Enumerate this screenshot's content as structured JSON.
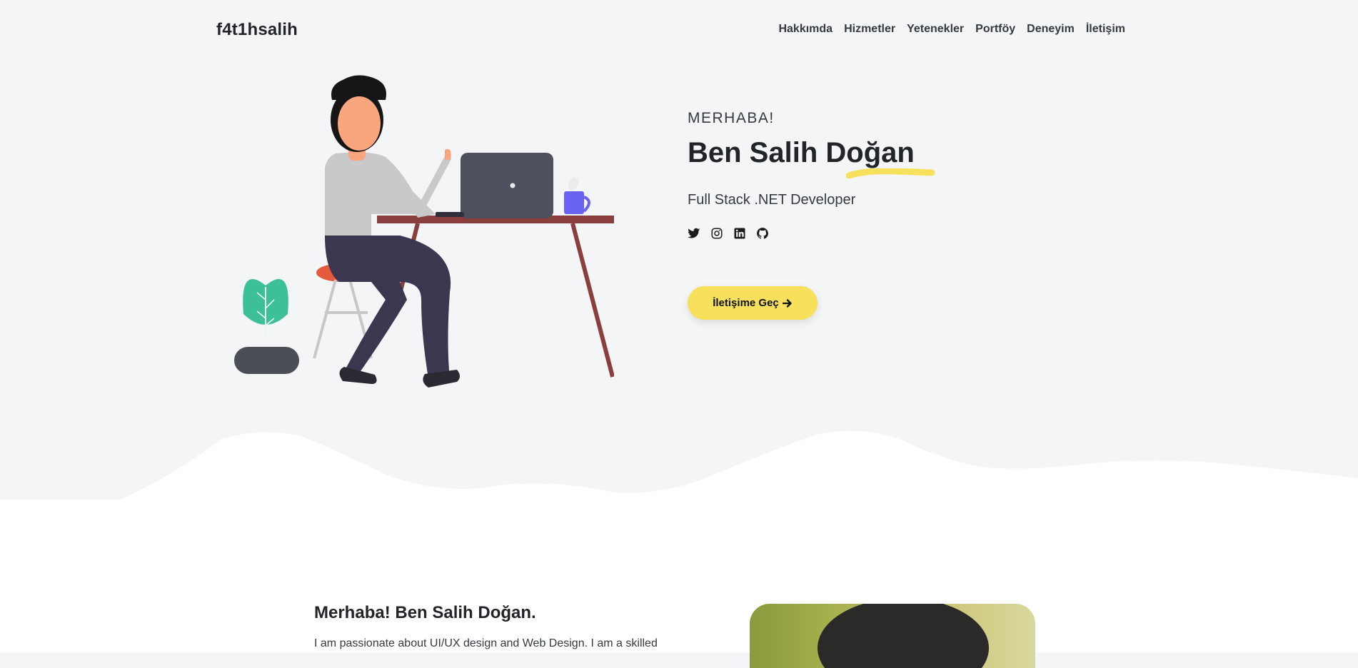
{
  "brand": "f4t1hsalih",
  "nav": {
    "items": [
      {
        "label": "Hakkımda"
      },
      {
        "label": "Hizmetler"
      },
      {
        "label": "Yetenekler"
      },
      {
        "label": "Portföy"
      },
      {
        "label": "Deneyim"
      },
      {
        "label": "İletişim"
      }
    ]
  },
  "hero": {
    "greeting": "MERHABA!",
    "name": "Ben Salih Doğan",
    "role": "Full Stack .NET Developer",
    "socials": [
      {
        "icon": "twitter-icon"
      },
      {
        "icon": "instagram-icon"
      },
      {
        "icon": "linkedin-icon"
      },
      {
        "icon": "github-icon"
      }
    ],
    "cta_label": "İletişime Geç",
    "accent_color": "#f7e15c"
  },
  "about": {
    "title": "Merhaba! Ben Salih Doğan.",
    "text": "I am passionate about UI/UX design and Web Design. I am a skilled"
  }
}
